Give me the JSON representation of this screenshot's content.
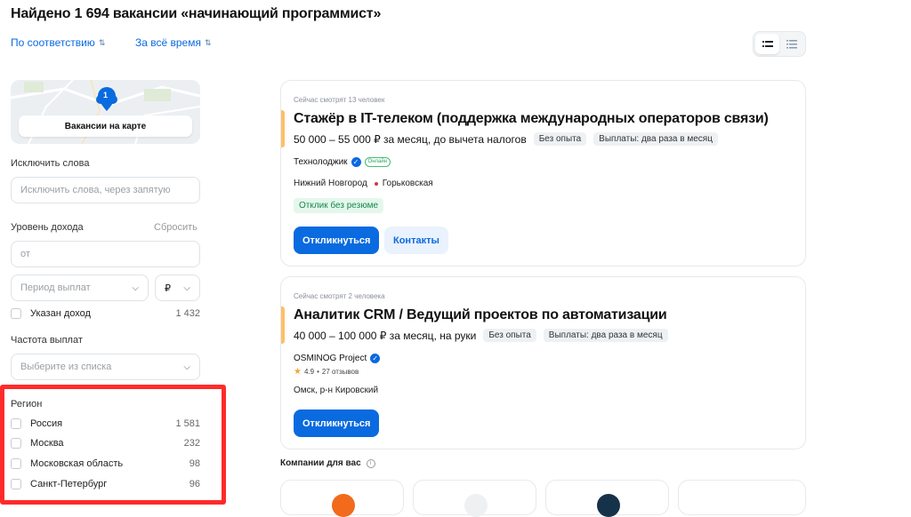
{
  "header": {
    "title": "Найдено 1 694 вакансии «начинающий программист»"
  },
  "sorting": {
    "relevance_label": "По соответствию",
    "period_label": "За всё время"
  },
  "map": {
    "pin_count": "1",
    "button_label": "Вакансии на карте"
  },
  "filters": {
    "exclude_words": {
      "label": "Исключить слова",
      "placeholder": "Исключить слова, через запятую"
    },
    "income": {
      "label": "Уровень дохода",
      "reset_label": "Сбросить",
      "from_placeholder": "от",
      "period_placeholder": "Период выплат",
      "currency": "₽"
    },
    "income_specified": {
      "label": "Указан доход",
      "count": "1 432"
    },
    "pay_frequency": {
      "label": "Частота выплат",
      "placeholder": "Выберите из списка"
    },
    "region": {
      "label": "Регион",
      "items": [
        {
          "label": "Россия",
          "count": "1 581"
        },
        {
          "label": "Москва",
          "count": "232"
        },
        {
          "label": "Московская область",
          "count": "98"
        },
        {
          "label": "Санкт-Петербург",
          "count": "96"
        }
      ]
    }
  },
  "vacancies": [
    {
      "watching": "Сейчас смотрят 13 человек",
      "title": "Стажёр в IT-телеком (поддержка международных операторов связи)",
      "salary": "50 000 – 55 000 ₽ за месяц, до вычета налогов",
      "tags": [
        "Без опыта",
        "Выплаты: два раза в месяц"
      ],
      "employer": "Технолоджик",
      "online_badge": "Онлайн",
      "city": "Нижний Новгород",
      "metro": "Горьковская",
      "no_resume": "Отклик без резюме",
      "apply_label": "Откликнуться",
      "contacts_label": "Контакты"
    },
    {
      "watching": "Сейчас смотрят 2 человека",
      "title": "Аналитик CRM / Ведущий проектов по автоматизации",
      "salary": "40 000 – 100 000 ₽ за месяц, на руки",
      "tags": [
        "Без опыта",
        "Выплаты: два раза в месяц"
      ],
      "employer": "OSMINOG Project",
      "rating": "4.9",
      "reviews": "27 отзывов",
      "city": "Омск, р-н Кировский",
      "apply_label": "Откликнуться"
    }
  ],
  "companies": {
    "label": "Компании для вас"
  },
  "colors": {
    "accent": "#0a6adf",
    "highlight_box": "#ff2b2b",
    "card_bar": "#ffbf66"
  }
}
